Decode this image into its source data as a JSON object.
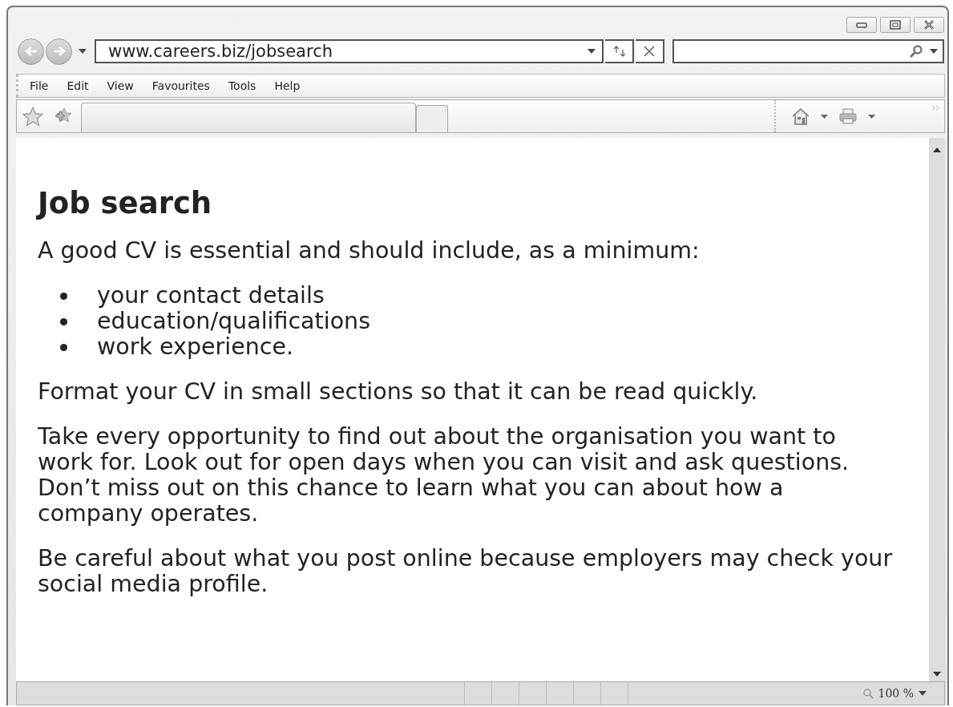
{
  "address_bar": {
    "value": "www.careers.biz/jobsearch"
  },
  "menu": [
    {
      "label": "File"
    },
    {
      "label": "Edit"
    },
    {
      "label": "View"
    },
    {
      "label": "Favourites"
    },
    {
      "label": "Tools"
    },
    {
      "label": "Help"
    }
  ],
  "content": [
    {
      "kind": "heading",
      "text": "Job search"
    },
    {
      "kind": "paragraph",
      "lines": [
        "A good CV is essential and should include, as a minimum:"
      ]
    },
    {
      "kind": "list",
      "items": [
        "your contact details",
        "education/qualifications",
        "work experience."
      ]
    },
    {
      "kind": "paragraph",
      "lines": [
        "Format your CV in small sections so that it can be read quickly."
      ]
    },
    {
      "kind": "paragraph",
      "lines": [
        "Take every opportunity to find out about the organisation you want to",
        "work for. Look out for open days when you can visit and ask questions.",
        "Don’t miss out on this chance to learn what you can about how a",
        "company operates."
      ]
    },
    {
      "kind": "paragraph",
      "lines": [
        "Be careful about what you post online because employers may check your",
        "social media profile."
      ]
    }
  ],
  "status_bar": {
    "zoom": "100 %"
  }
}
